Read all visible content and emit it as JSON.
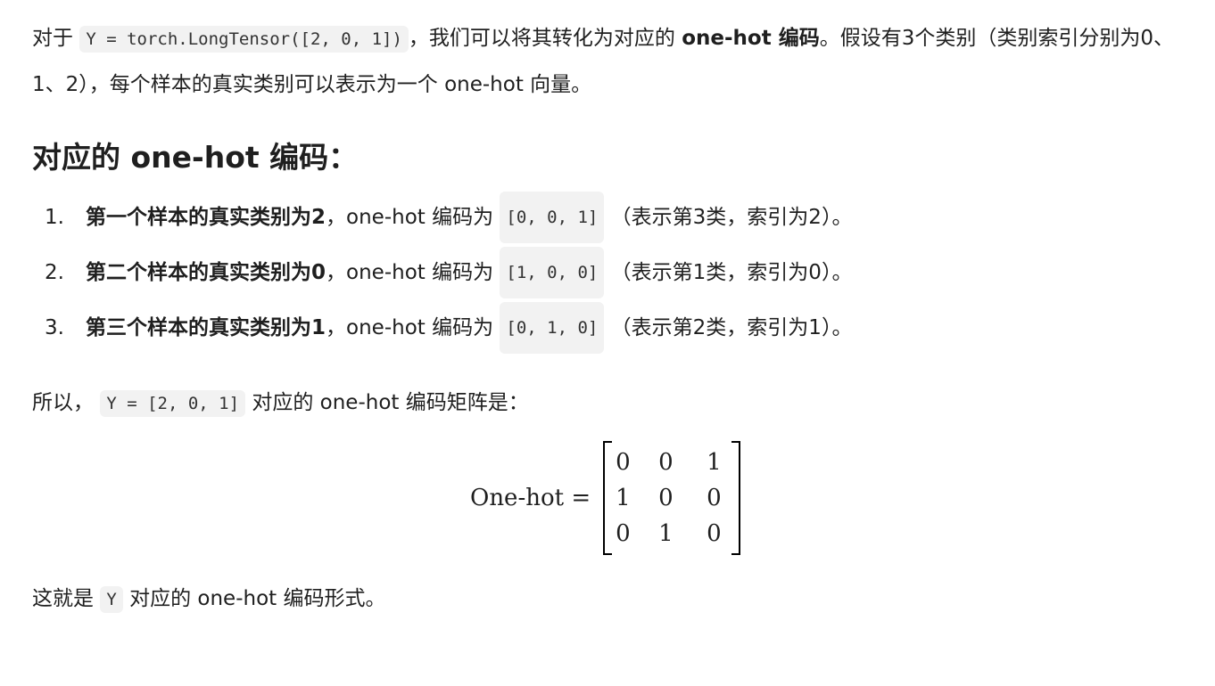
{
  "intro": {
    "prefix": "对于",
    "code": "Y = torch.LongTensor([2, 0, 1])",
    "middle": "，我们可以将其转化为对应的",
    "bold": "one-hot 编码",
    "suffix": "。假设有3个类别（类别索引分别为0、1、2），每个样本的真实类别可以表示为一个 one-hot 向量。"
  },
  "heading": "对应的 one-hot 编码：",
  "list": [
    {
      "num": "1.",
      "bold": "第一个样本的真实类别为2",
      "text1": "，one-hot 编码为",
      "code": "[0, 0, 1]",
      "text2": "（表示第3类，索引为2）。"
    },
    {
      "num": "2.",
      "bold": "第二个样本的真实类别为0",
      "text1": "，one-hot 编码为",
      "code": "[1, 0, 0]",
      "text2": "（表示第1类，索引为0）。"
    },
    {
      "num": "3.",
      "bold": "第三个样本的真实类别为1",
      "text1": "，one-hot 编码为",
      "code": "[0, 1, 0]",
      "text2": "（表示第2类，索引为1）。"
    }
  ],
  "summary": {
    "prefix": "所以，",
    "code": "Y = [2, 0, 1]",
    "suffix": "对应的 one-hot 编码矩阵是："
  },
  "matrix": {
    "label": "One-hot =",
    "cells": [
      "0",
      "0",
      "1",
      "1",
      "0",
      "0",
      "0",
      "1",
      "0"
    ]
  },
  "closing": {
    "prefix": "这就是",
    "code": "Y",
    "suffix": "对应的 one-hot 编码形式。"
  }
}
